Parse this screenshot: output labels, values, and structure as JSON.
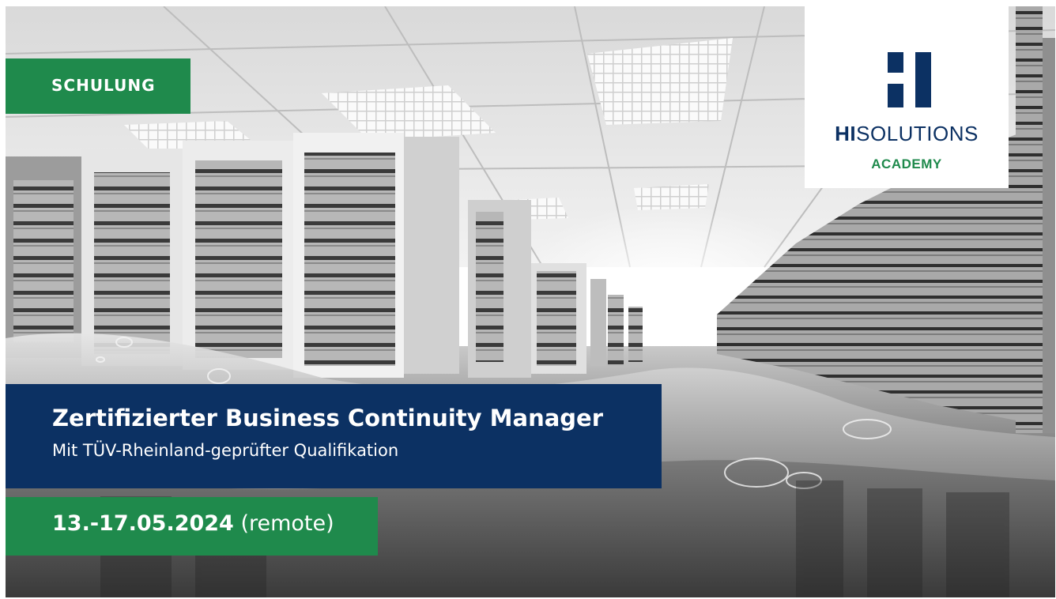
{
  "badge": {
    "label": "SCHULUNG",
    "color": "#1f8a4c"
  },
  "course": {
    "title": "Zertifizierter Business Continuity Manager",
    "subtitle": "Mit TÜV-Rheinland-geprüfter Qualifikation",
    "color": "#0c3163"
  },
  "schedule": {
    "date": "13.-17.05.2024",
    "mode": "(remote)"
  },
  "logo": {
    "brand_bold": "HI",
    "brand_rest": "SOLUTIONS",
    "division": "ACADEMY",
    "mark_icon": "hi-logo-mark-icon"
  },
  "background": {
    "scene": "server-room-photo"
  }
}
